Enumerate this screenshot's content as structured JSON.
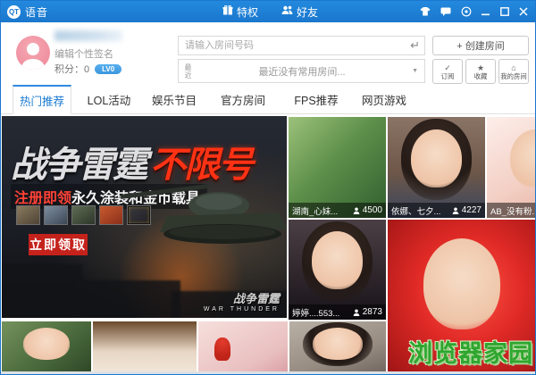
{
  "app": {
    "logo": "QT",
    "title": "语音"
  },
  "titlebar": {
    "privilege": "特权",
    "friends": "好友"
  },
  "profile": {
    "signature": "编辑个性签名",
    "points": "积分：0",
    "level": "LV0"
  },
  "room_bar": {
    "input_placeholder": "请输入房间号码",
    "recent_label": "最近",
    "recent_text": "最近没有常用房间...",
    "create_room": "+ 创建房间",
    "subscribe": "订阅",
    "favorite": "收藏",
    "my_room": "我的房间"
  },
  "tabs": [
    {
      "label": "热门推荐",
      "active": true
    },
    {
      "label": "LOL活动",
      "active": false
    },
    {
      "label": "娱乐节目",
      "active": false
    },
    {
      "label": "官方房间",
      "active": false
    },
    {
      "label": "FPS推荐",
      "active": false
    },
    {
      "label": "网页游戏",
      "active": false
    }
  ],
  "banner": {
    "headline_silver": "战争雷霆",
    "headline_red": "不限号",
    "sub_red": "注册即领",
    "sub_white": "永久涂装和金币载具",
    "cta": "立即领取",
    "brand_cn": "战争雷霆",
    "brand_en": "WAR THUNDER"
  },
  "rooms": {
    "r1": {
      "name": "湖南_心妹...",
      "viewers": "4500"
    },
    "r2": {
      "name": "依娜、七夕...",
      "viewers": "4227"
    },
    "r3": {
      "name": "AB_没有粉...",
      "viewers": ""
    },
    "r4": {
      "name": "婷婷....553...",
      "viewers": "2873"
    }
  },
  "watermark": "浏览器家园",
  "icons": {
    "enter": "↵",
    "caret": "▼",
    "check": "✓",
    "star": "★",
    "home": "⌂"
  },
  "colors": {
    "titlebar_blue": "#1a77cd",
    "accent_blue": "#1a7ad0",
    "cta_red": "#c5221c",
    "badge_blue": "#3b96dd",
    "watermark_green": "#2ea62e"
  }
}
